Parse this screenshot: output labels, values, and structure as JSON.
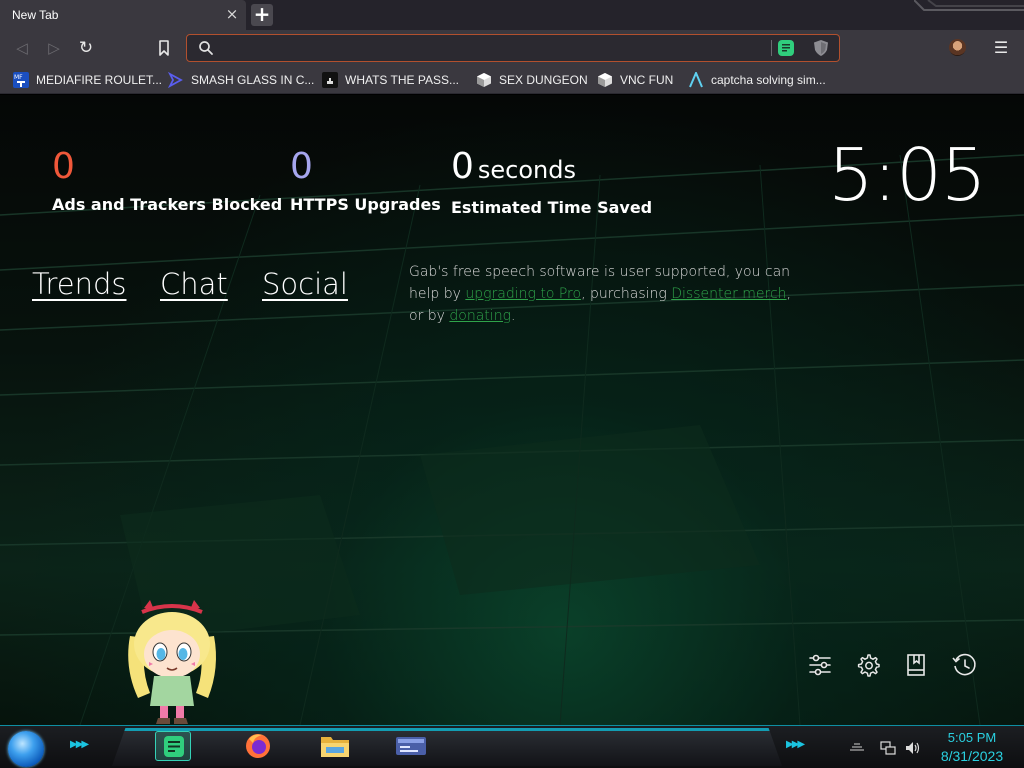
{
  "browser": {
    "tab": {
      "title": "New Tab",
      "close_glyph": "×"
    },
    "new_tab_glyph": "+",
    "nav": {
      "back": "◁",
      "forward": "▷",
      "reload": "↻",
      "menu": "☰"
    },
    "url": {
      "value": "",
      "placeholder": ""
    },
    "bookmarks": [
      {
        "label": "MEDIAFIRE ROULET...",
        "icon": "mediafire-icon"
      },
      {
        "label": "SMASH GLASS IN C...",
        "icon": "smash-glass-icon"
      },
      {
        "label": "WHATS THE PASS...",
        "icon": "terminal-icon"
      },
      {
        "label": "SEX DUNGEON",
        "icon": "cube-icon"
      },
      {
        "label": "VNC FUN",
        "icon": "cube-icon"
      },
      {
        "label": "captcha solving sim...",
        "icon": "caret-a-icon"
      }
    ]
  },
  "stats": {
    "ads": {
      "value": "0",
      "label": "Ads and Trackers Blocked"
    },
    "https": {
      "value": "0",
      "label": "HTTPS Upgrades"
    },
    "time": {
      "value": "0",
      "unit": "seconds",
      "label": "Estimated Time Saved"
    }
  },
  "clock": "5:05",
  "links": {
    "trends": "Trends",
    "chat": "Chat",
    "social": "Social"
  },
  "support": {
    "part1": "Gab's free speech software is user supported, you can help by ",
    "link1": "upgrading to Pro",
    "part2": ", purchasing ",
    "link2": "Dissenter merch",
    "part3": ", or by ",
    "link3": "donating",
    "part4": "."
  },
  "controls": [
    "customize-icon",
    "settings-icon",
    "bookmarks-icon",
    "history-icon"
  ],
  "taskbar": {
    "time": "5:05 PM",
    "date": "8/31/2023",
    "apps": [
      "gab-dissenter-icon",
      "firefox-icon",
      "file-explorer-icon",
      "control-panel-icon"
    ]
  },
  "colors": {
    "ads_value": "#f0583a",
    "https_value": "#a6a6ee",
    "link_green": "#2fa34a",
    "accent_cyan": "#2ad0e0",
    "url_border": "#b2502e"
  }
}
